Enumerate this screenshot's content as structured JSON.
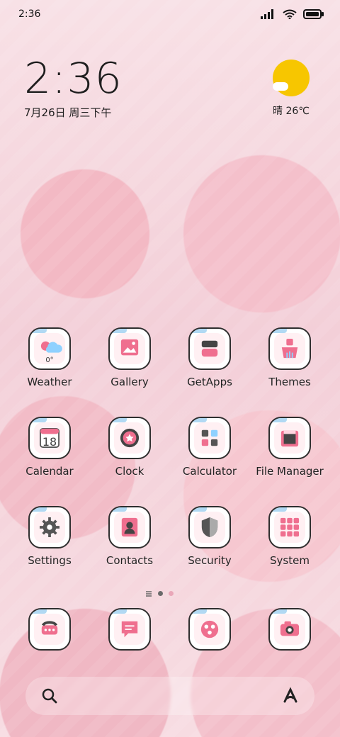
{
  "status_bar": {
    "time": "2:36"
  },
  "clock_widget": {
    "time": "2:36",
    "date": "7月26日 周三下午"
  },
  "weather_widget": {
    "text": "晴 26℃"
  },
  "apps": [
    {
      "name": "Weather",
      "icon": "weather-icon",
      "sub": "0°"
    },
    {
      "name": "Gallery",
      "icon": "gallery-icon"
    },
    {
      "name": "GetApps",
      "icon": "getapps-icon"
    },
    {
      "name": "Themes",
      "icon": "themes-icon"
    },
    {
      "name": "Calendar",
      "icon": "calendar-icon",
      "sub": "18"
    },
    {
      "name": "Clock",
      "icon": "clock-icon"
    },
    {
      "name": "Calculator",
      "icon": "calculator-icon"
    },
    {
      "name": "File Manager",
      "icon": "file-manager-icon"
    },
    {
      "name": "Settings",
      "icon": "settings-icon"
    },
    {
      "name": "Contacts",
      "icon": "contacts-icon"
    },
    {
      "name": "Security",
      "icon": "security-icon"
    },
    {
      "name": "System",
      "icon": "system-folder-icon"
    }
  ],
  "dock": [
    {
      "icon": "phone-icon"
    },
    {
      "icon": "messages-icon"
    },
    {
      "icon": "browser-icon"
    },
    {
      "icon": "camera-icon"
    }
  ],
  "search_bar": {
    "left_icon": "search-icon",
    "right_icon": "assistant-icon"
  },
  "colors": {
    "accent": "#ef6f8f",
    "icon_border": "#2f2f2f",
    "icon_bg": "#ffffff"
  }
}
